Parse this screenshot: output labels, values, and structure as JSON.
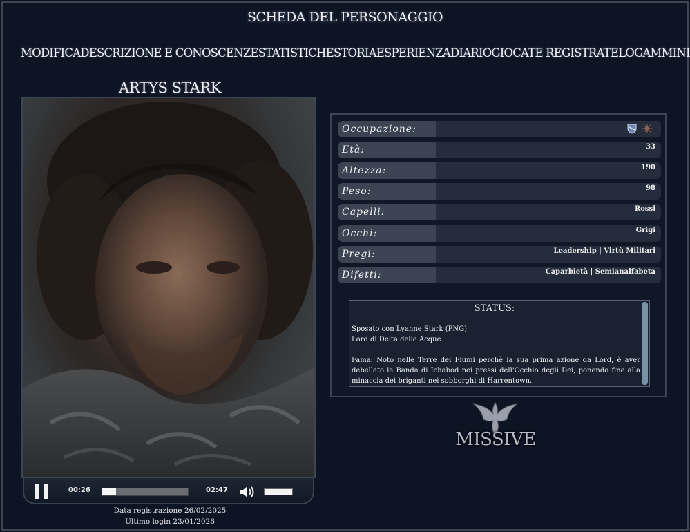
{
  "page_title": "SCHEDA DEL PERSONAGGIO",
  "nav": [
    "MODIFICA",
    "DESCRIZIONE E CONOSCENZE",
    "STATISTICHE",
    "STORIA",
    "ESPERIENZA",
    "DIARIO",
    "GIOCATE REGISTRATE",
    "LOG",
    "AMMINISTRA"
  ],
  "character_name": "ARTYS STARK",
  "player": {
    "current_time": "00:26",
    "total_time": "02:47",
    "progress": 0.16,
    "volume": 0.9
  },
  "registration": "Data registrazione 26/02/2025",
  "last_login": "Ultimo login 23/01/2026",
  "details": [
    {
      "label": "Occupazione:",
      "value": ""
    },
    {
      "label": "Età:",
      "value": "33"
    },
    {
      "label": "Altezza:",
      "value": "190"
    },
    {
      "label": "Peso:",
      "value": "98"
    },
    {
      "label": "Capelli:",
      "value": "Rossi"
    },
    {
      "label": "Occhi:",
      "value": "Grigi"
    },
    {
      "label": "Pregi:",
      "value": "Leadership | Virtù Militari"
    },
    {
      "label": "Difetti:",
      "value": "Caparbietà | Semianalfabeta"
    }
  ],
  "occupation_icons": [
    "shield-icon",
    "sigil-icon"
  ],
  "status": {
    "title": "STATUS:",
    "line1": "Sposato con Lyanne Stark (PNG)",
    "line2": "Lord di Delta delle Acque",
    "fama": "Fama: Noto nelle Terre dei Fiumi perchè la sua prima azione da Lord, è aver debellato la Banda di Ichabod nei pressi dell'Occhio degli Dei, ponendo fine alla minaccia dei briganti nei sobborghi di Harrentown."
  },
  "missive_label": "MISSIVE"
}
